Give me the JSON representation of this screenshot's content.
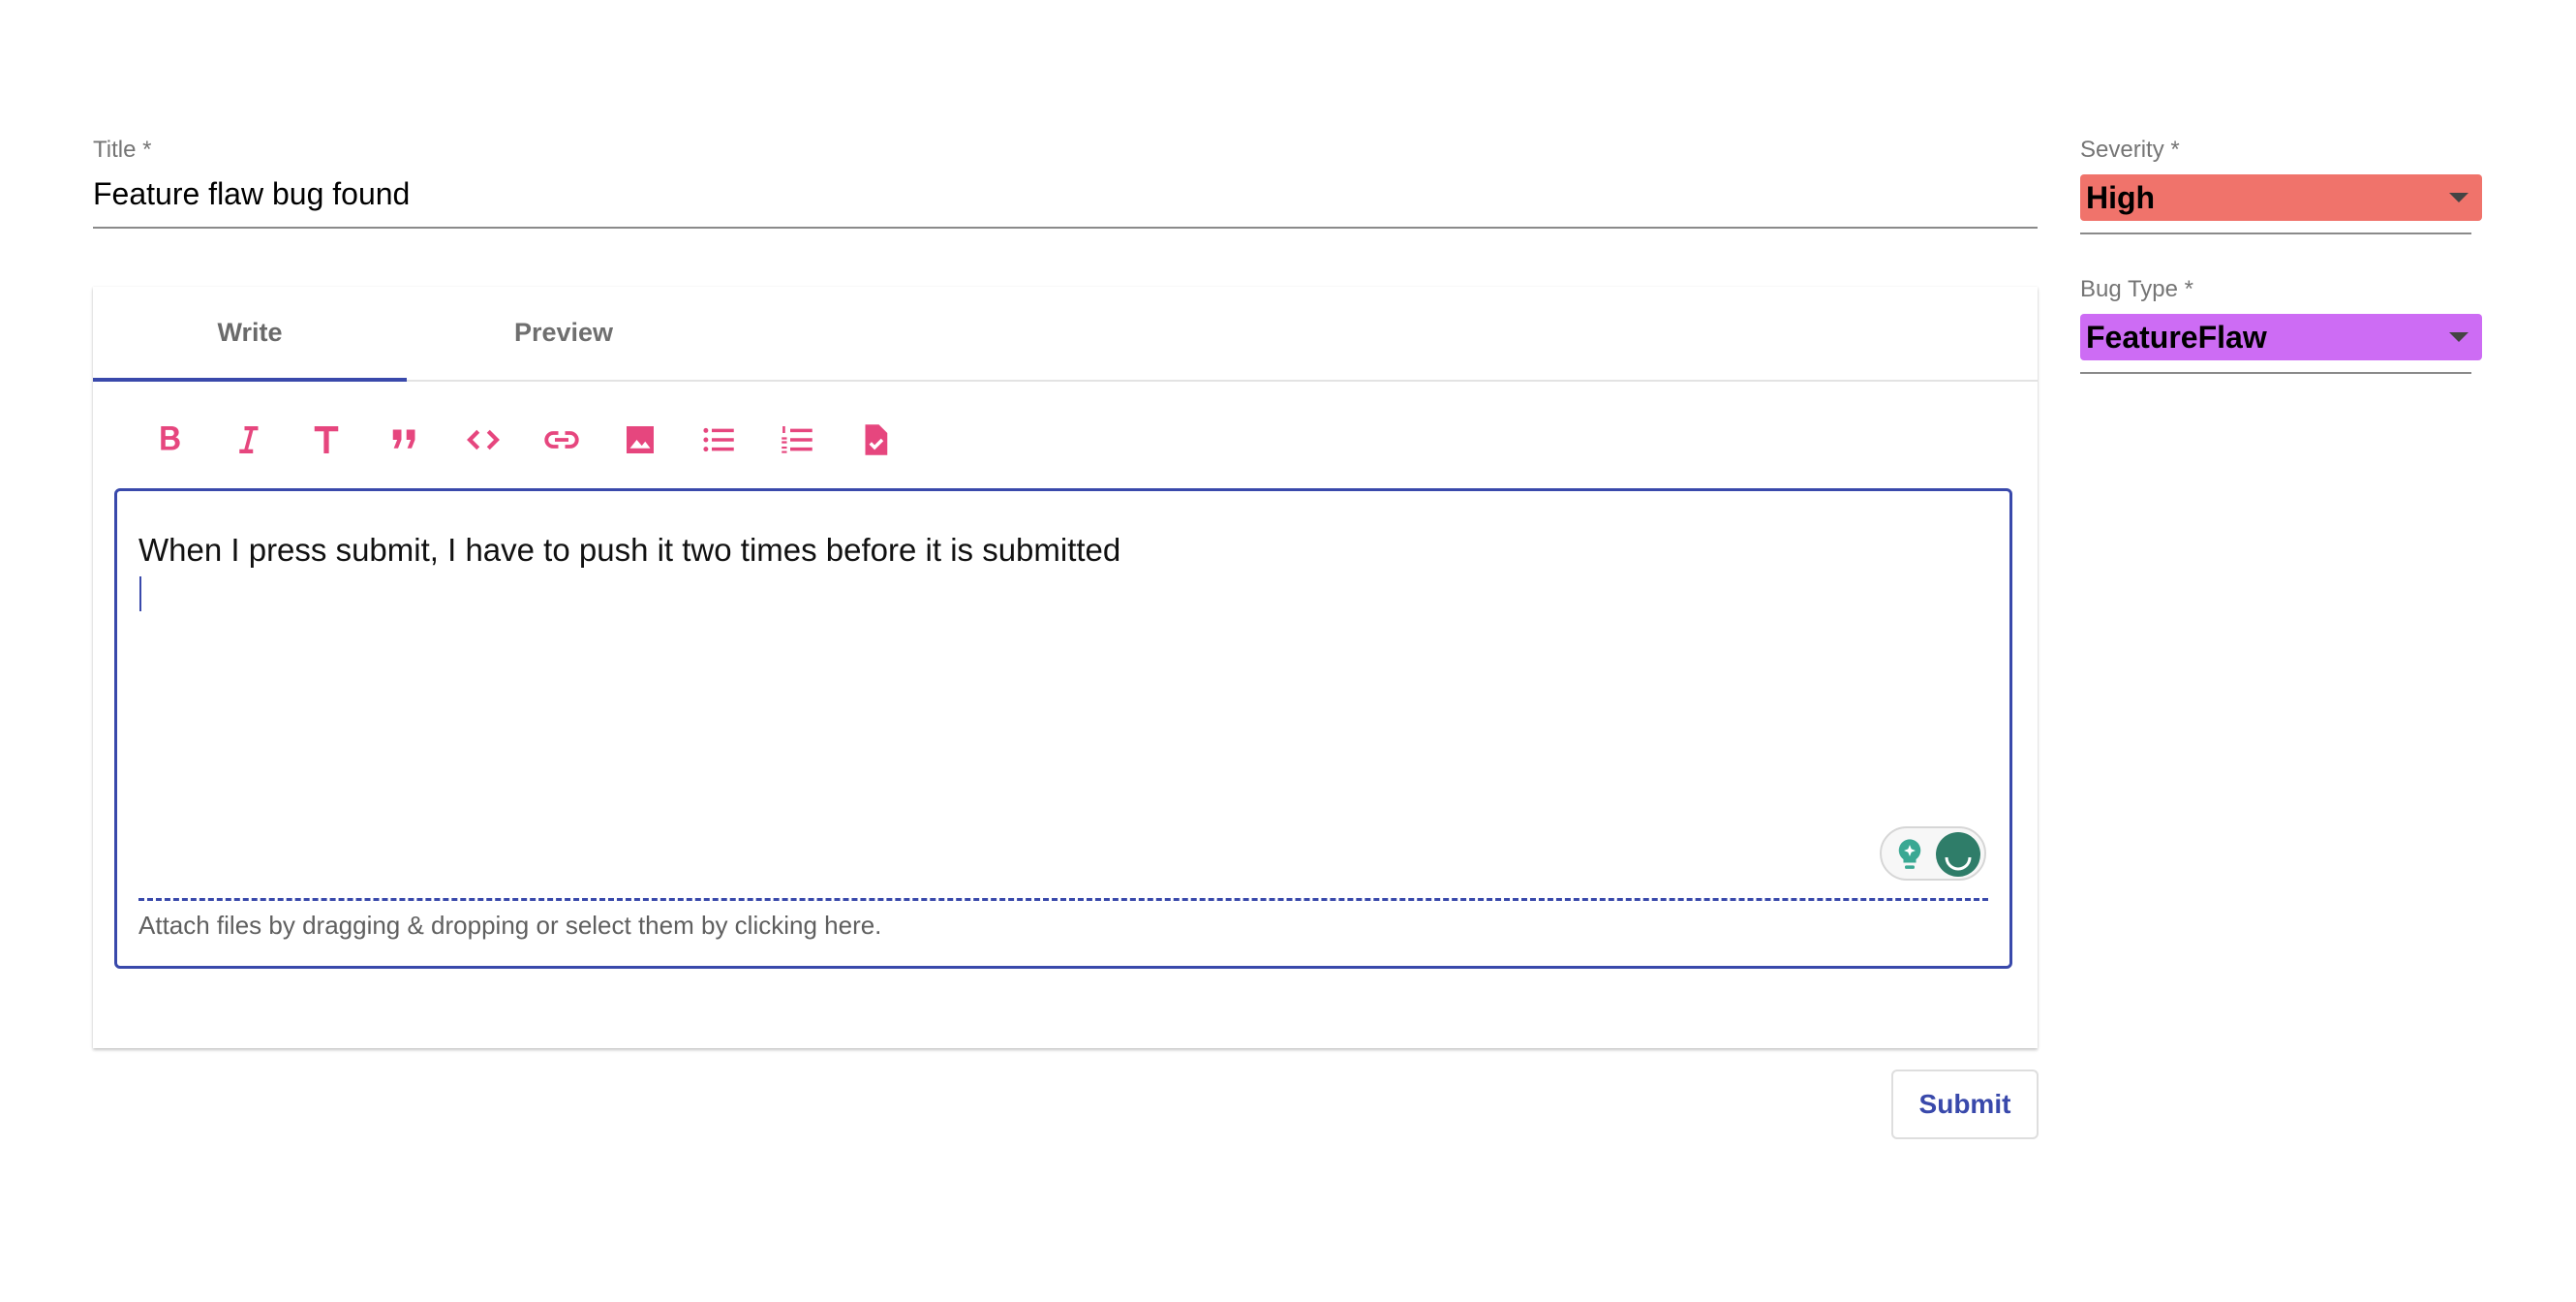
{
  "form": {
    "title_label": "Title *",
    "title_value": "Feature flaw bug found",
    "tabs": [
      {
        "label": "Write"
      },
      {
        "label": "Preview"
      }
    ],
    "toolbar_icons": [
      "bold-icon",
      "italic-icon",
      "header-icon",
      "quote-icon",
      "code-icon",
      "link-icon",
      "image-icon",
      "unordered-list-icon",
      "ordered-list-icon",
      "checked-list-icon"
    ],
    "editor_text": "When I press submit, I have to push it two times before it is submitted",
    "dropzone_text": "Attach files by dragging & dropping or select them by clicking here.",
    "submit_label": "Submit"
  },
  "sidebar": {
    "severity": {
      "label": "Severity *",
      "value": "High",
      "color": "#f0736b"
    },
    "bug_type": {
      "label": "Bug Type *",
      "value": "FeatureFlaw",
      "color": "#cd6cf4"
    }
  },
  "colors": {
    "accent": "#3949ab",
    "icon": "#e6467e"
  }
}
